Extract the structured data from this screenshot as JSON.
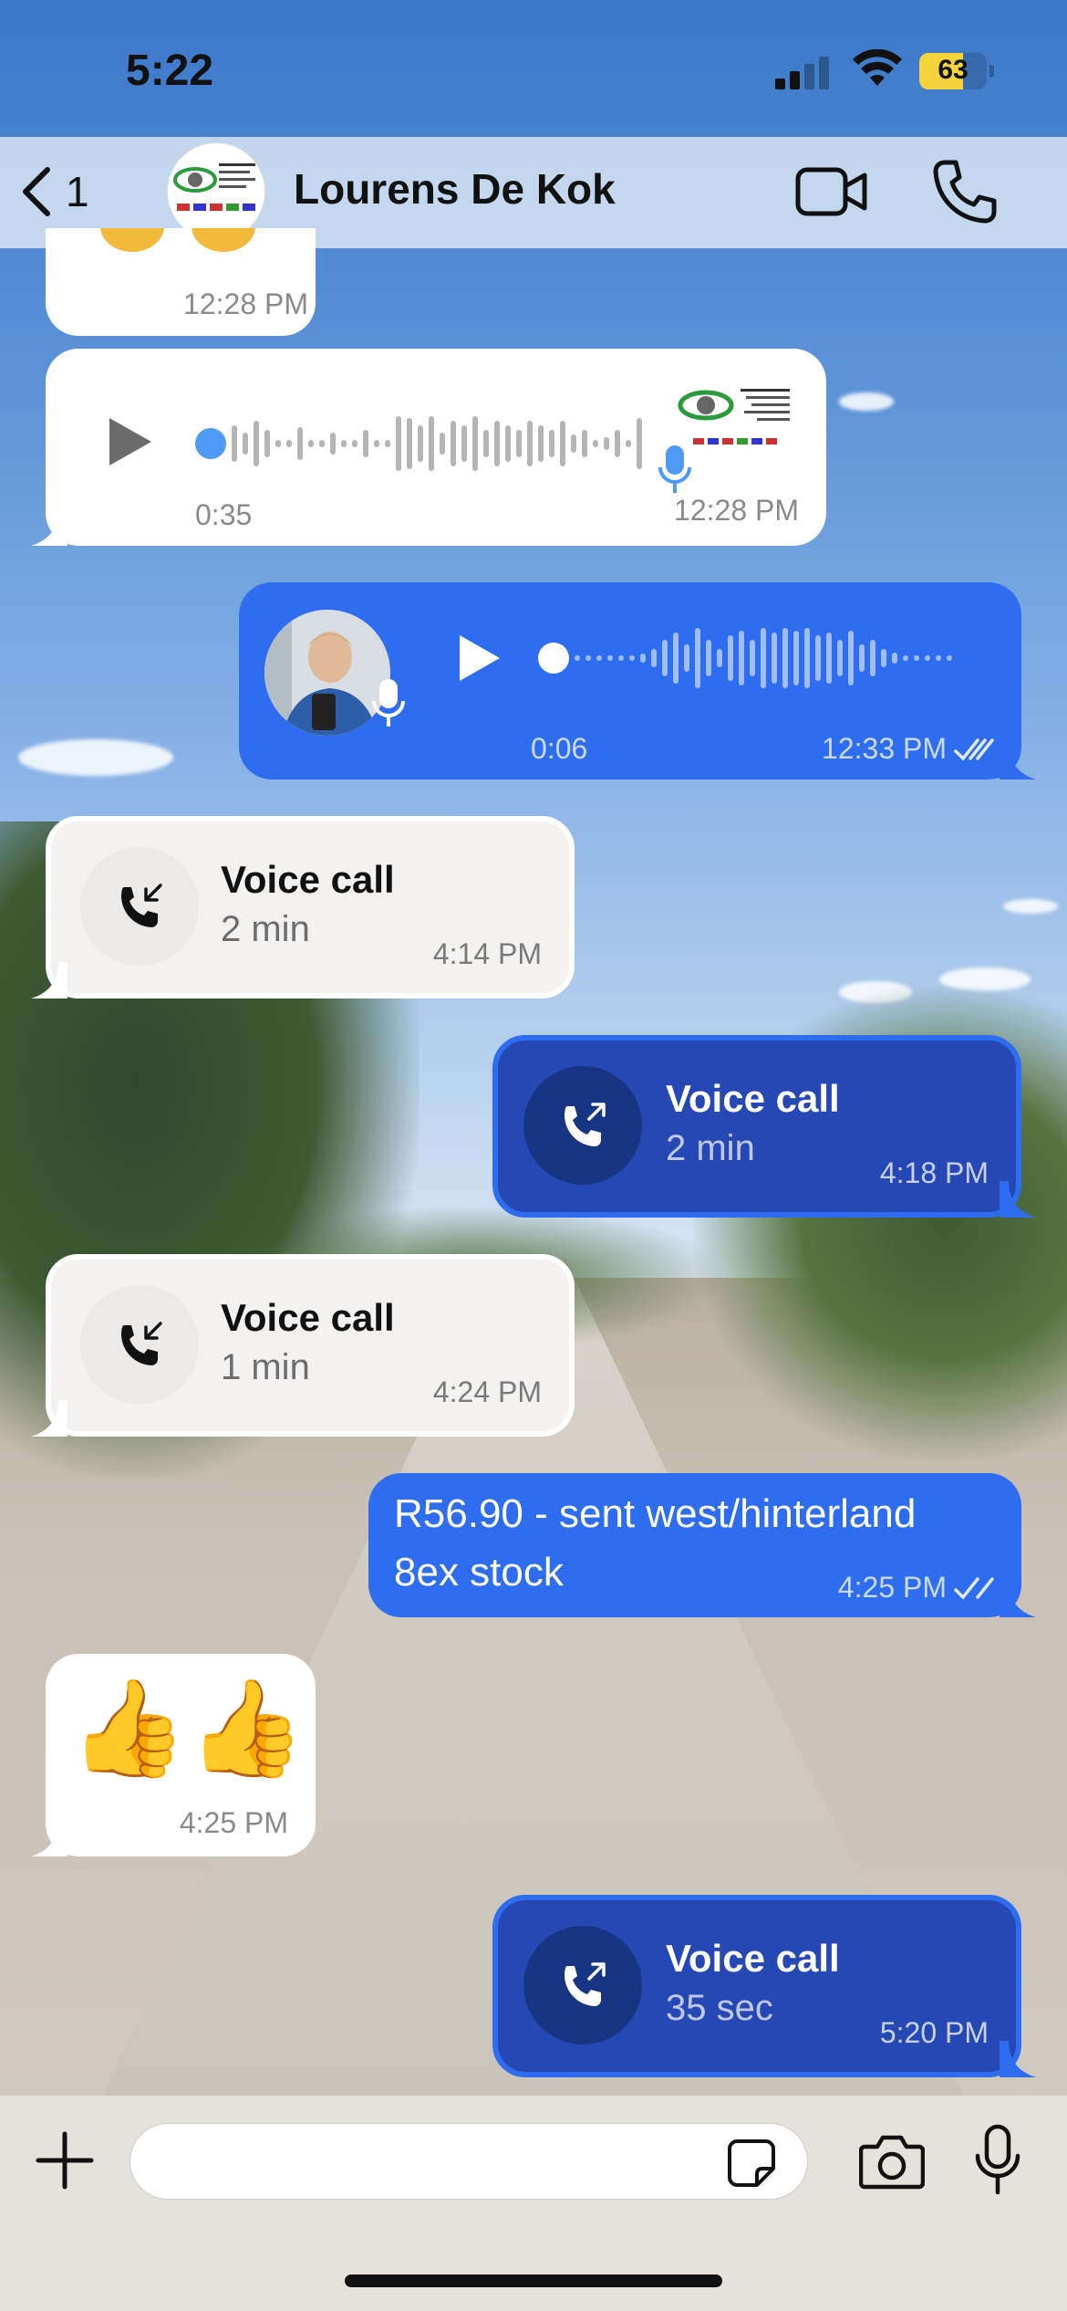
{
  "status_bar": {
    "time": "5:22",
    "battery": "63"
  },
  "header": {
    "back_count": "1",
    "contact_name": "Lourens De Kok"
  },
  "messages": {
    "m0": {
      "time": "12:28 PM"
    },
    "m1": {
      "duration": "0:35",
      "time": "12:28 PM"
    },
    "m2": {
      "duration": "0:06",
      "time": "12:33 PM"
    },
    "m3": {
      "title": "Voice call",
      "duration": "2 min",
      "time": "4:14 PM"
    },
    "m4": {
      "title": "Voice call",
      "duration": "2 min",
      "time": "4:18 PM"
    },
    "m5": {
      "title": "Voice call",
      "duration": "1 min",
      "time": "4:24 PM"
    },
    "m6": {
      "text_line1": "R56.90 - sent west/hinterland",
      "text_line2": "8ex stock",
      "time": "4:25 PM"
    },
    "m7": {
      "emoji": "👍👍",
      "time": "4:25 PM"
    },
    "m8": {
      "title": "Voice call",
      "duration": "35 sec",
      "time": "5:20 PM"
    }
  },
  "composer": {
    "value": ""
  },
  "colors": {
    "outgoing": "#2f6df0",
    "outgoing_call": "#2648b5",
    "incoming": "#ffffff",
    "incoming_call": "#f3f2f0"
  },
  "icons": [
    "chevron-left-icon",
    "video-camera-icon",
    "phone-icon",
    "play-icon",
    "microphone-icon",
    "incoming-call-icon",
    "outgoing-call-icon",
    "double-check-icon",
    "plus-icon",
    "sticker-icon",
    "camera-icon"
  ]
}
